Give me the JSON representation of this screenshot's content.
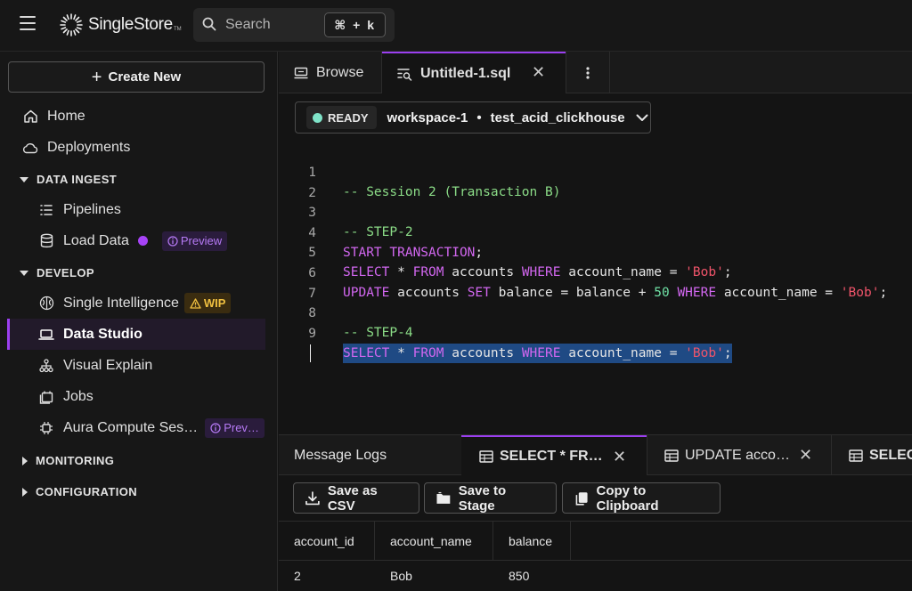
{
  "header": {
    "logo_text": "SingleStore",
    "logo_tm": "TM",
    "search_placeholder": "Search",
    "search_shortcut": "⌘ + k"
  },
  "sidebar": {
    "create_label": "Create New",
    "home": "Home",
    "deployments": "Deployments",
    "section_data_ingest": "DATA INGEST",
    "pipelines": "Pipelines",
    "load_data": "Load Data",
    "load_data_badge": "Preview",
    "section_develop": "DEVELOP",
    "single_intelligence": "Single Intelligence",
    "single_intelligence_badge": "WIP",
    "data_studio": "Data Studio",
    "visual_explain": "Visual Explain",
    "jobs": "Jobs",
    "aura": "Aura Compute Ses…",
    "aura_badge": "Prev…",
    "section_monitoring": "MONITORING",
    "section_configuration": "CONFIGURATION"
  },
  "tabs": {
    "browse": "Browse",
    "untitled": "Untitled-1.sql"
  },
  "workspace": {
    "status": "READY",
    "name": "workspace-1",
    "separator": "•",
    "database": "test_acid_clickhouse"
  },
  "editor": {
    "line_numbers": [
      "1",
      "2",
      "3",
      "4",
      "5",
      "6",
      "7",
      "8",
      "9"
    ],
    "tokens": {
      "l1": "-- Session 2 (Transaction B)",
      "l3": "-- STEP-2",
      "l4_kw": "START TRANSACTION",
      "l4_end": ";",
      "select": "SELECT",
      "star": " * ",
      "from": "FROM",
      "accounts": " accounts ",
      "where": "WHERE",
      "account_name_eq": " account_name = ",
      "bob": "'Bob'",
      "semi": ";",
      "update": "UPDATE",
      "set": "SET",
      "balance_expr": " balance = balance + ",
      "fifty": "50",
      "l8": "-- STEP-4"
    }
  },
  "results": {
    "tab_logs": "Message Logs",
    "tab_select": "SELECT * FR…",
    "tab_update": "UPDATE acco…",
    "tab_select2": "SELEC",
    "btn_csv": "Save as CSV",
    "btn_stage": "Save to Stage",
    "btn_clipboard": "Copy to Clipboard",
    "columns": [
      "account_id",
      "account_name",
      "balance"
    ],
    "rows": [
      [
        "2",
        "Bob",
        "850"
      ]
    ]
  },
  "colors": {
    "accent": "#9b3ff0",
    "ready": "#7fe3c8",
    "keyword": "#d267f0",
    "comment": "#8bdc87",
    "string": "#f0546a",
    "number": "#6fe0a4"
  }
}
